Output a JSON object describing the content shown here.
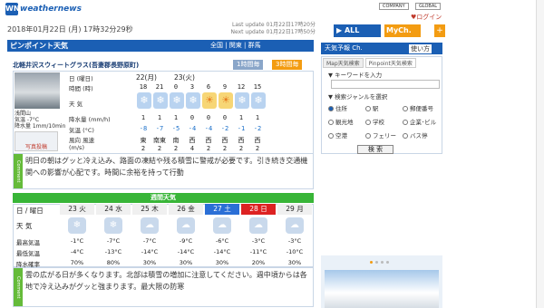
{
  "header": {
    "logo_mark": "WN",
    "logo_text": "weathernews",
    "links": [
      "COMPANY",
      "GLOBAL"
    ],
    "login": "♥ログイン",
    "date": "2018年01月22日 (月) 17時32分29秒",
    "last_update": "Last update  01月22日17時20分",
    "next_update": "Next update  01月22日17時50分"
  },
  "pinpoint": {
    "title": "ピンポイント天気",
    "region": "全国 | 関東 | 群馬",
    "place": "北軽井沢スウィートグラス(吾妻郡長野原町)",
    "tab_1h": "1時間毎",
    "tab_3h": "3時間毎",
    "cam_label": "浅間山",
    "cam_temp": "気温 -7°C",
    "cam_rain": "降水量 1mm/10min",
    "camera_btn": "写真投稿",
    "rows": {
      "date": "日 (曜日)",
      "time": "時間 (時)",
      "weather": "天 気",
      "rain": "降水量 (mm/h)",
      "temp": "気温 (°C)",
      "wind": "風向 風速 (m/s)"
    },
    "day1": "22(月)",
    "day2": "23(火)",
    "hours": [
      "18",
      "21",
      "0",
      "3",
      "6",
      "9",
      "12",
      "15"
    ],
    "rain": [
      "1",
      "1",
      "1",
      "0",
      "0",
      "0",
      "1",
      "1"
    ],
    "temp": [
      "-8",
      "-7",
      "-5",
      "-4",
      "-4",
      "-2",
      "-1",
      "-2"
    ],
    "wind_dir": [
      "東",
      "南東",
      "南",
      "西",
      "西",
      "西",
      "西",
      "西"
    ],
    "wind_spd": [
      "2",
      "2",
      "2",
      "4",
      "2",
      "2",
      "2",
      "2"
    ],
    "comment": "明日の朝はグッと冷え込み、路面の凍結や残る積雪に警戒が必要です。引き続き交通機関への影響が心配です。時間に余裕を持って行動"
  },
  "weekly": {
    "title": "週間天気",
    "day_label": "日 / 曜日",
    "weather_label": "天 気",
    "max_label": "最高気温",
    "min_label": "最低気温",
    "rain_label": "降水確率",
    "days": [
      "23 火",
      "24 水",
      "25 木",
      "26 金",
      "27 土",
      "28 日",
      "29 月"
    ],
    "max": [
      "-1°C",
      "-7°C",
      "-7°C",
      "-9°C",
      "-6°C",
      "-3°C",
      "-3°C"
    ],
    "min": [
      "-4°C",
      "-13°C",
      "-14°C",
      "-14°C",
      "-14°C",
      "-11°C",
      "-10°C"
    ],
    "pop": [
      "70%",
      "80%",
      "30%",
      "30%",
      "30%",
      "20%",
      "30%"
    ],
    "comment": "雲の広がる日が多くなります。北部は積雪の増加に注意してください。週中頃からは各地で冷え込みがグッと強まります。最大限の防寒",
    "comment_tag": "Comment"
  },
  "right": {
    "all_channel": "▶ ALL Channel",
    "mych": "MyCh.",
    "plus": "+",
    "title": "天気予報 Ch.",
    "use": "使い方",
    "tab1": "Map天気検索",
    "tab2": "Pinpoint天気検索",
    "kw_label": "▼ キーワードを入力",
    "genre_label": "▼ 検索ジャンルを選択",
    "options": [
      "住所",
      "駅",
      "郵便番号",
      "観光地",
      "学校",
      "企業･ビル",
      "空港",
      "フェリー",
      "バス停"
    ],
    "search": "検 索"
  },
  "colors": {
    "brand": "#1b5fb4",
    "accent": "#f39c12",
    "green": "#38b537",
    "sat": "#2b6fd6",
    "sun": "#d22"
  }
}
